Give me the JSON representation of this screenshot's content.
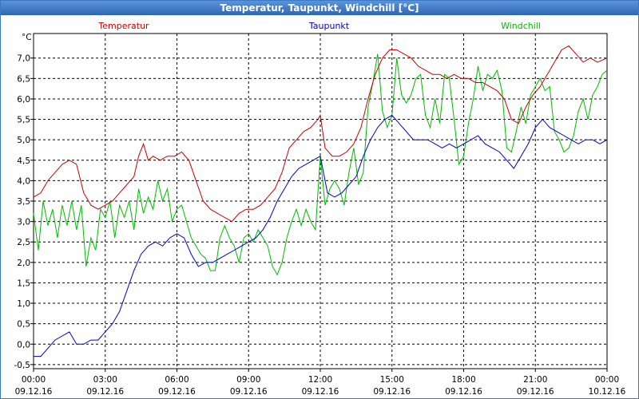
{
  "chart_data": {
    "type": "line",
    "title": "Temperatur, Taupunkt, Windchill [°C]",
    "ylabel": "°C",
    "ylim": [
      -0.6,
      7.6
    ],
    "yticks": [
      -0.5,
      0.0,
      0.5,
      1.0,
      1.5,
      2.0,
      2.5,
      3.0,
      3.5,
      4.0,
      4.5,
      5.0,
      5.5,
      6.0,
      6.5,
      7.0
    ],
    "ytick_labels": [
      "-0,5",
      "0,0",
      "0,5",
      "1,0",
      "1,5",
      "2,0",
      "2,5",
      "3,0",
      "3,5",
      "4,0",
      "4,5",
      "5,0",
      "5,5",
      "6,0",
      "6,5",
      "7,0"
    ],
    "xlim": [
      0,
      24
    ],
    "xticks": [
      0,
      3,
      6,
      9,
      12,
      15,
      18,
      21,
      24
    ],
    "xtick_times": [
      "00:00",
      "03:00",
      "06:00",
      "09:00",
      "12:00",
      "15:00",
      "18:00",
      "21:00",
      "00:00"
    ],
    "xtick_dates": [
      "09.12.16",
      "09.12.16",
      "09.12.16",
      "09.12.16",
      "09.12.16",
      "09.12.16",
      "09.12.16",
      "09.12.16",
      "10.12.16"
    ],
    "grid": true,
    "legend_position": "top",
    "series": [
      {
        "name": "Temperatur",
        "color": "#cc0000",
        "x": [
          0,
          0.3,
          0.6,
          0.9,
          1.2,
          1.5,
          1.8,
          2.1,
          2.4,
          2.7,
          3.0,
          3.3,
          3.6,
          3.9,
          4.2,
          4.4,
          4.6,
          4.8,
          5.0,
          5.3,
          5.6,
          5.9,
          6.2,
          6.5,
          6.8,
          7.1,
          7.4,
          7.7,
          8.0,
          8.3,
          8.6,
          8.9,
          9.2,
          9.5,
          9.8,
          10.1,
          10.4,
          10.7,
          11.0,
          11.3,
          11.6,
          11.9,
          12.0,
          12.2,
          12.5,
          12.8,
          13.1,
          13.4,
          13.7,
          14.0,
          14.3,
          14.6,
          14.9,
          15.2,
          15.5,
          15.8,
          16.1,
          16.4,
          16.7,
          17.0,
          17.3,
          17.6,
          17.9,
          18.2,
          18.5,
          18.8,
          19.1,
          19.4,
          19.7,
          20.0,
          20.3,
          20.6,
          20.9,
          21.2,
          21.5,
          21.8,
          22.1,
          22.4,
          22.7,
          23.0,
          23.3,
          23.6,
          24.0
        ],
        "y": [
          3.6,
          3.7,
          4.0,
          4.2,
          4.4,
          4.5,
          4.4,
          3.7,
          3.4,
          3.3,
          3.4,
          3.5,
          3.7,
          3.9,
          4.1,
          4.6,
          4.9,
          4.5,
          4.6,
          4.5,
          4.6,
          4.6,
          4.7,
          4.5,
          4.0,
          3.5,
          3.3,
          3.2,
          3.1,
          3.0,
          3.2,
          3.3,
          3.3,
          3.4,
          3.6,
          3.8,
          4.2,
          4.8,
          5.0,
          5.2,
          5.3,
          5.5,
          5.6,
          4.8,
          4.6,
          4.6,
          4.7,
          4.9,
          5.3,
          6.0,
          6.6,
          7.0,
          7.2,
          7.2,
          7.1,
          7.0,
          6.8,
          6.7,
          6.6,
          6.6,
          6.5,
          6.6,
          6.5,
          6.5,
          6.4,
          6.4,
          6.3,
          6.2,
          6.0,
          5.5,
          5.4,
          5.8,
          6.1,
          6.3,
          6.6,
          6.9,
          7.2,
          7.3,
          7.1,
          6.9,
          7.0,
          6.9,
          7.0
        ]
      },
      {
        "name": "Taupunkt",
        "color": "#0000cc",
        "x": [
          0,
          0.3,
          0.6,
          0.9,
          1.2,
          1.5,
          1.8,
          2.1,
          2.4,
          2.7,
          3.0,
          3.3,
          3.6,
          3.9,
          4.2,
          4.5,
          4.8,
          5.1,
          5.4,
          5.7,
          6.0,
          6.3,
          6.6,
          6.9,
          7.2,
          7.5,
          7.8,
          8.1,
          8.4,
          8.7,
          9.0,
          9.3,
          9.6,
          9.9,
          10.2,
          10.5,
          10.8,
          11.1,
          11.4,
          11.7,
          12.0,
          12.3,
          12.6,
          12.9,
          13.2,
          13.5,
          13.8,
          14.1,
          14.4,
          14.7,
          15.0,
          15.3,
          15.6,
          15.9,
          16.2,
          16.5,
          16.8,
          17.1,
          17.4,
          17.7,
          18.0,
          18.3,
          18.6,
          18.9,
          19.2,
          19.5,
          19.8,
          20.1,
          20.4,
          20.7,
          21.0,
          21.3,
          21.6,
          21.9,
          22.2,
          22.5,
          22.8,
          23.1,
          23.4,
          23.7,
          24.0
        ],
        "y": [
          -0.3,
          -0.3,
          -0.1,
          0.1,
          0.2,
          0.3,
          0.0,
          0.0,
          0.1,
          0.1,
          0.3,
          0.5,
          0.8,
          1.3,
          1.8,
          2.2,
          2.4,
          2.5,
          2.4,
          2.6,
          2.7,
          2.6,
          2.2,
          1.9,
          2.0,
          2.0,
          2.1,
          2.2,
          2.3,
          2.4,
          2.5,
          2.6,
          2.8,
          3.1,
          3.5,
          3.8,
          4.1,
          4.3,
          4.4,
          4.5,
          4.6,
          3.7,
          3.6,
          3.7,
          3.9,
          4.1,
          4.6,
          5.0,
          5.3,
          5.5,
          5.6,
          5.4,
          5.2,
          5.0,
          5.0,
          5.0,
          4.9,
          4.8,
          4.9,
          4.8,
          4.9,
          5.0,
          5.1,
          4.9,
          4.8,
          4.7,
          4.5,
          4.3,
          4.6,
          4.9,
          5.3,
          5.5,
          5.3,
          5.2,
          5.1,
          5.0,
          4.9,
          5.0,
          5.0,
          4.9,
          5.0
        ]
      },
      {
        "name": "Windchill",
        "color": "#00bb00",
        "x": [
          0,
          0.2,
          0.4,
          0.6,
          0.8,
          1.0,
          1.2,
          1.4,
          1.6,
          1.8,
          2.0,
          2.2,
          2.4,
          2.6,
          2.8,
          3.0,
          3.2,
          3.4,
          3.6,
          3.8,
          4.0,
          4.2,
          4.4,
          4.6,
          4.8,
          5.0,
          5.2,
          5.4,
          5.6,
          5.8,
          6.0,
          6.2,
          6.4,
          6.6,
          6.8,
          7.0,
          7.2,
          7.4,
          7.6,
          7.8,
          8.0,
          8.2,
          8.4,
          8.6,
          8.8,
          9.0,
          9.2,
          9.4,
          9.6,
          9.8,
          10.0,
          10.2,
          10.4,
          10.6,
          10.8,
          11.0,
          11.2,
          11.4,
          11.6,
          11.8,
          12.0,
          12.2,
          12.4,
          12.6,
          12.8,
          13.0,
          13.2,
          13.4,
          13.6,
          13.8,
          14.0,
          14.2,
          14.4,
          14.6,
          14.8,
          15.0,
          15.2,
          15.4,
          15.6,
          15.8,
          16.0,
          16.2,
          16.4,
          16.6,
          16.8,
          17.0,
          17.2,
          17.4,
          17.6,
          17.8,
          18.0,
          18.2,
          18.4,
          18.6,
          18.8,
          19.0,
          19.2,
          19.4,
          19.6,
          19.8,
          20.0,
          20.2,
          20.4,
          20.6,
          20.8,
          21.0,
          21.2,
          21.4,
          21.6,
          21.8,
          22.0,
          22.2,
          22.4,
          22.6,
          22.8,
          23.0,
          23.2,
          23.4,
          23.6,
          23.8,
          24.0
        ],
        "y": [
          3.2,
          2.3,
          3.5,
          2.9,
          3.3,
          2.6,
          3.4,
          2.9,
          3.5,
          2.8,
          3.4,
          1.9,
          2.6,
          2.3,
          3.3,
          3.1,
          3.5,
          2.6,
          3.4,
          3.1,
          3.5,
          2.8,
          3.8,
          3.2,
          3.6,
          3.3,
          4.0,
          3.5,
          3.8,
          3.0,
          3.3,
          3.4,
          3.0,
          2.6,
          2.4,
          2.2,
          2.1,
          1.8,
          1.8,
          2.6,
          2.9,
          2.6,
          2.4,
          2.0,
          2.6,
          2.7,
          2.5,
          2.8,
          2.6,
          2.4,
          1.9,
          1.7,
          2.0,
          2.6,
          3.0,
          3.3,
          2.9,
          3.3,
          3.0,
          2.8,
          4.6,
          3.4,
          3.8,
          4.0,
          3.8,
          3.4,
          4.2,
          4.8,
          3.9,
          4.2,
          5.8,
          6.4,
          7.1,
          5.7,
          5.3,
          5.6,
          7.0,
          6.1,
          5.9,
          6.1,
          6.5,
          6.6,
          5.6,
          5.3,
          6.0,
          5.4,
          6.6,
          6.5,
          5.5,
          4.4,
          4.6,
          5.4,
          6.0,
          6.8,
          6.2,
          6.6,
          6.5,
          6.7,
          6.2,
          4.8,
          4.7,
          5.2,
          5.8,
          5.4,
          6.1,
          6.3,
          6.5,
          6.2,
          6.3,
          5.2,
          5.0,
          4.7,
          4.8,
          5.1,
          5.7,
          6.0,
          5.5,
          6.1,
          6.3,
          6.6,
          6.7
        ]
      }
    ]
  }
}
